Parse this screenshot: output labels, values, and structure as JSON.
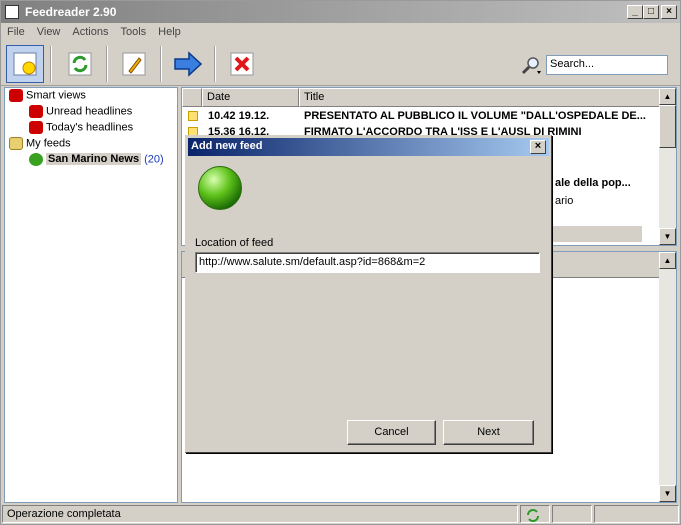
{
  "app": {
    "title": "Feedreader 2.90"
  },
  "window_controls": {
    "minimize": "_",
    "maximize": "□",
    "close": "×"
  },
  "menu": [
    "File",
    "View",
    "Actions",
    "Tools",
    "Help"
  ],
  "search": {
    "placeholder": "Search..."
  },
  "tree": {
    "smart_views": "Smart views",
    "unread": "Unread headlines",
    "today": "Today's headlines",
    "my_feeds": "My feeds",
    "feed_name": "San Marino News",
    "feed_count": "(20)"
  },
  "list": {
    "col_date": "Date",
    "col_title": "Title",
    "rows": [
      {
        "date": "10.42 19.12.",
        "title": "PRESENTATO AL PUBBLICO IL VOLUME \"DALL'OSPEDALE DE..."
      },
      {
        "date": "15.36 16.12.",
        "title": "FIRMATO L'ACCORDO TRA L'ISS E L'AUSL DI RIMINI"
      }
    ],
    "partial_1": "ale della pop...",
    "partial_2": "ario"
  },
  "status": {
    "text": "Operazione completata"
  },
  "dialog": {
    "title": "Add new feed",
    "close": "×",
    "label": "Location of feed",
    "url": "http://www.salute.sm/default.asp?id=868&m=2",
    "cancel": "Cancel",
    "next": "Next"
  }
}
